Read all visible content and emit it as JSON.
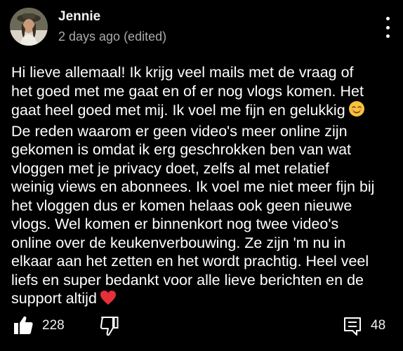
{
  "comment": {
    "author": "Jennie",
    "timestamp": "2 days ago (edited)",
    "avatar_icon": "avatar-photo-icon",
    "lines": [
      "Hi lieve allemaal! Ik krijg veel mails met de vraag of",
      "het goed met me gaat en of er nog vlogs komen. Het",
      "gaat heel goed met mij. Ik voel me fijn en gelukkig",
      "De reden waarom er geen video's meer online zijn",
      "gekomen is omdat ik erg geschrokken ben van wat",
      "vloggen met je privacy doet, zelfs al met relatief",
      "weinig views en abonnees. Ik voel me niet meer fijn bij",
      "het vloggen dus er komen helaas ook geen nieuwe",
      "vlogs. Wel komen er binnenkort nog twee video's",
      "online over de keukenverbouwing. Ze zijn 'm nu in",
      "elkaar aan het zetten en het wordt prachtig. Heel veel",
      "liefs en super bedankt voor alle lieve berichten en de",
      "support altijd"
    ],
    "emoji_line3": "smiling-face-emoji",
    "emoji_line13": "red-heart-emoji"
  },
  "actions": {
    "like_count": "228",
    "reply_count": "48",
    "like_icon": "thumbs-up-icon",
    "dislike_icon": "thumbs-down-icon",
    "reply_icon": "comment-icon",
    "more_icon": "more-vertical-icon"
  },
  "colors": {
    "background": "#000000",
    "text": "#ffffff",
    "secondary_text": "#aaaaaa",
    "heart": "#e5303a",
    "emoji_face": "#f7c23c"
  }
}
